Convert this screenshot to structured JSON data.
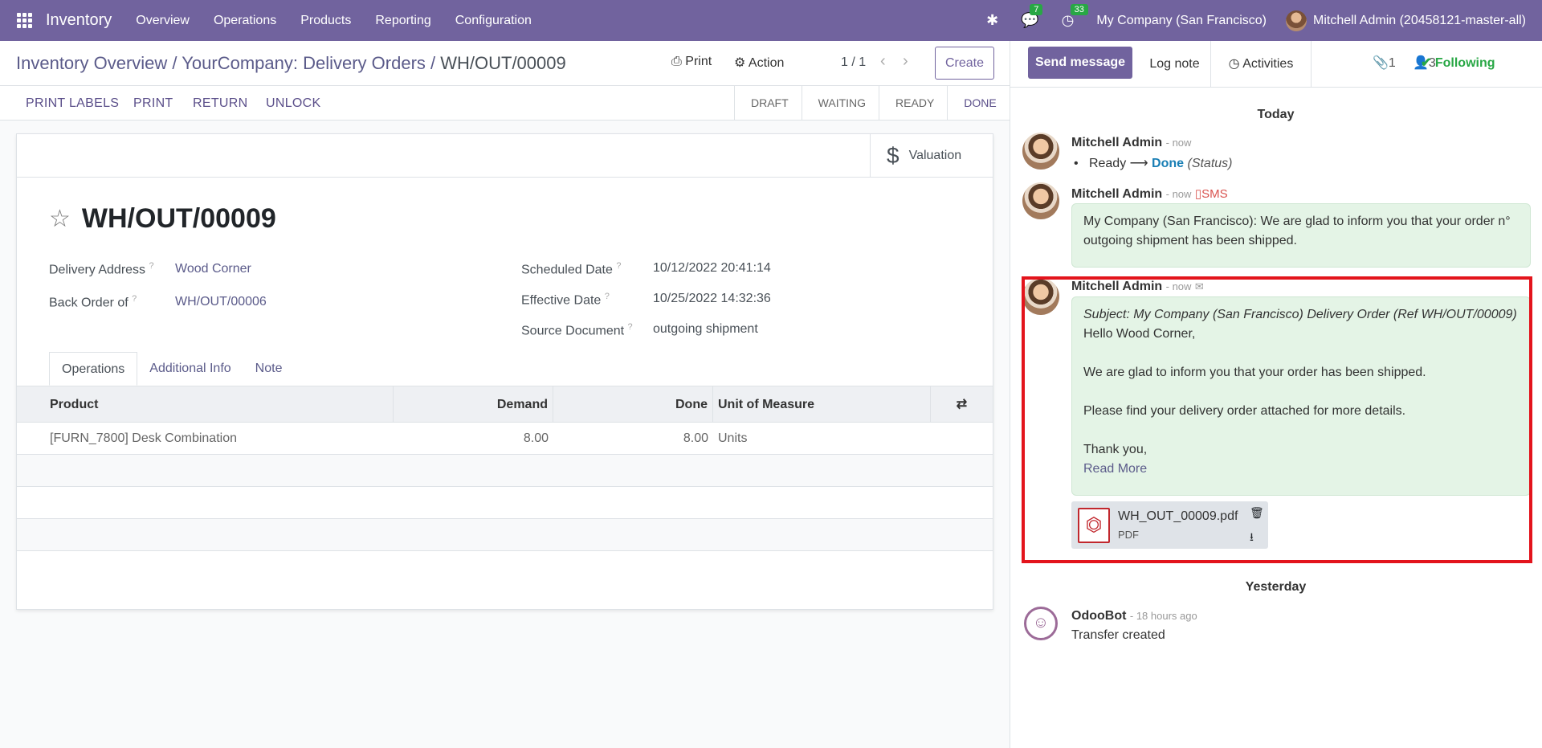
{
  "topbar": {
    "app_name": "Inventory",
    "nav": [
      "Overview",
      "Operations",
      "Products",
      "Reporting",
      "Configuration"
    ],
    "messages_count": "7",
    "activities_count": "33",
    "company": "My Company (San Francisco)",
    "user": "Mitchell Admin (20458121-master-all)"
  },
  "control_panel": {
    "breadcrumb": [
      "Inventory Overview",
      "YourCompany: Delivery Orders",
      "WH/OUT/00009"
    ],
    "print_label": "Print",
    "action_label": "Action",
    "pager": "1 / 1",
    "create_label": "Create"
  },
  "statusbar": {
    "buttons": [
      "PRINT LABELS",
      "PRINT",
      "RETURN",
      "UNLOCK"
    ],
    "stages": [
      "DRAFT",
      "WAITING",
      "READY",
      "DONE"
    ],
    "active_stage": "DONE"
  },
  "form": {
    "valuation_label": "Valuation",
    "title": "WH/OUT/00009",
    "delivery_address_label": "Delivery Address",
    "delivery_address": "Wood Corner",
    "back_order_label": "Back Order of",
    "back_order": "WH/OUT/00006",
    "scheduled_date_label": "Scheduled Date",
    "scheduled_date": "10/12/2022 20:41:14",
    "effective_date_label": "Effective Date",
    "effective_date": "10/25/2022 14:32:36",
    "source_document_label": "Source Document",
    "source_document": "outgoing shipment",
    "help_mark": "?",
    "tabs": [
      "Operations",
      "Additional Info",
      "Note"
    ],
    "columns": [
      "Product",
      "Demand",
      "Done",
      "Unit of Measure"
    ],
    "rows": [
      {
        "product": "[FURN_7800] Desk Combination",
        "demand": "8.00",
        "done": "8.00",
        "uom": "Units"
      }
    ]
  },
  "chatter": {
    "send_message": "Send message",
    "log_note": "Log note",
    "activities": "Activities",
    "attachments_count": "1",
    "followers_count": "3",
    "following": "Following",
    "today": "Today",
    "yesterday": "Yesterday",
    "msg1": {
      "author": "Mitchell Admin",
      "time": "- now",
      "from": "Ready",
      "to": "Done",
      "field": "(Status)"
    },
    "msg2": {
      "author": "Mitchell Admin",
      "time": "- now",
      "type": "SMS",
      "body": "My Company (San Francisco): We are glad to inform you that your order n° outgoing shipment has been shipped."
    },
    "msg3": {
      "author": "Mitchell Admin",
      "time": "- now",
      "subject": "Subject: My Company (San Francisco) Delivery Order (Ref WH/OUT/00009)",
      "greeting": "Hello Wood Corner,",
      "line1": "We are glad to inform you that your order has been shipped.",
      "line2": "Please find your delivery order attached for more details.",
      "closing": "Thank you,",
      "read_more": "Read More",
      "attachment_name": "WH_OUT_00009.pdf",
      "attachment_type": "PDF"
    },
    "msg4": {
      "author": "OdooBot",
      "time": "- 18 hours ago",
      "body": "Transfer created"
    }
  },
  "colors": {
    "brand": "#71639e",
    "badge": "#28a745",
    "bubble": "#e4f4e6",
    "highlight": "#e3141c"
  }
}
